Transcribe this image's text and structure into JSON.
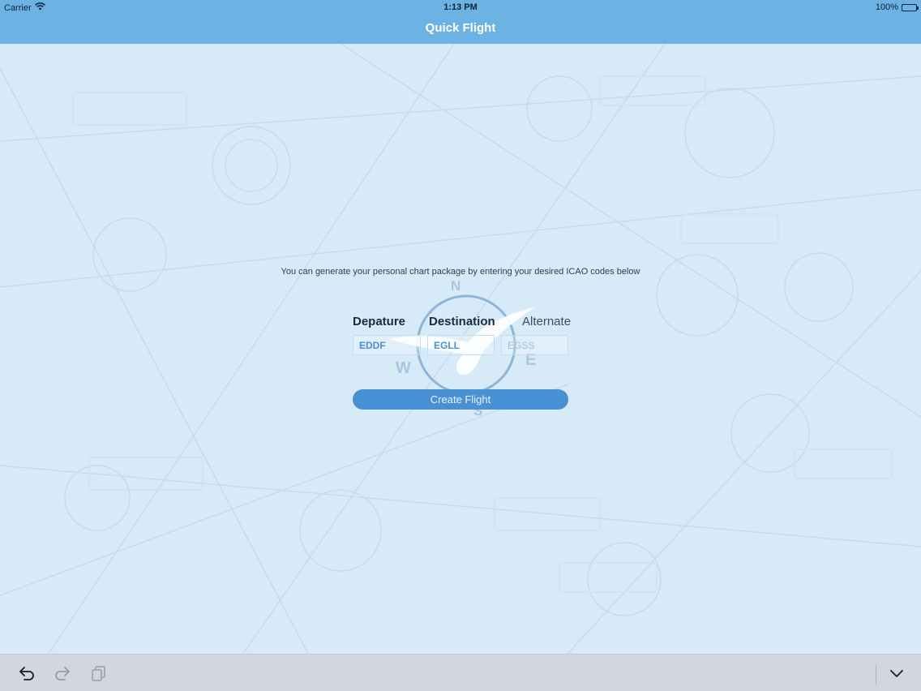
{
  "status_bar": {
    "carrier": "Carrier",
    "time": "1:13 PM",
    "battery": "100%",
    "battery_level": 1.0
  },
  "nav": {
    "title": "Quick Flight"
  },
  "main": {
    "intro_text": "You can generate your personal chart package by entering your desired ICAO codes below",
    "departure_label": "Depature",
    "destination_label": "Destination",
    "alternate_label": "Alternate",
    "departure_value": "EDDF",
    "destination_value": "EGLL",
    "alternate_placeholder": "EGSS",
    "create_button": "Create Flight"
  },
  "compass_letters": {
    "north": "N",
    "south": "S",
    "west": "W",
    "east": "E"
  },
  "icons": {
    "wifi": "wifi-icon",
    "battery": "battery-icon",
    "undo": "undo-icon",
    "redo": "redo-icon",
    "paste": "paste-icon",
    "hide_keyboard": "chevron-down-icon",
    "compass": "compass-logo-icon"
  },
  "colors": {
    "accent": "#6cb2e3",
    "button": "#4a90d4",
    "background": "#d6eaf8",
    "toolbar": "#d3d6df"
  }
}
